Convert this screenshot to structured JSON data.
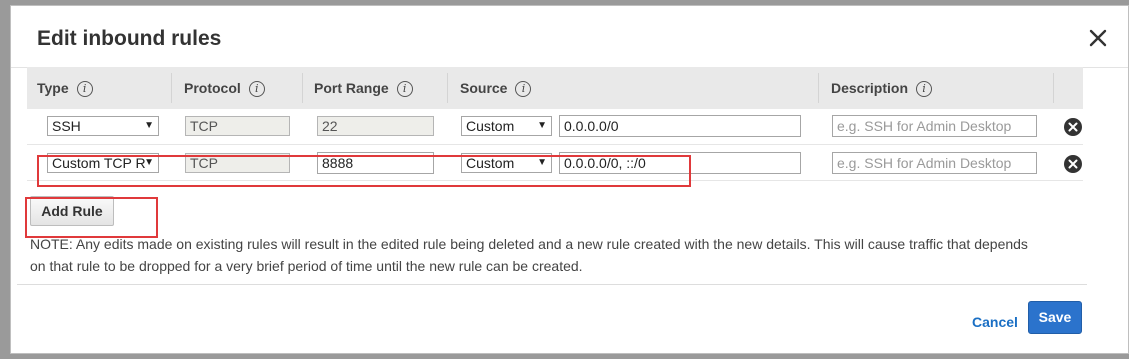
{
  "dialog": {
    "title": "Edit inbound rules",
    "close_icon": "close-icon"
  },
  "columns": {
    "type": "Type",
    "protocol": "Protocol",
    "port_range": "Port Range",
    "source": "Source",
    "description": "Description",
    "info_glyph": "i"
  },
  "rules": [
    {
      "type": "SSH",
      "protocol": "TCP",
      "port_range": "22",
      "source_mode": "Custom",
      "source_value": "0.0.0.0/0",
      "description_placeholder": "e.g. SSH for Admin Desktop"
    },
    {
      "type": "Custom TCP R",
      "protocol": "TCP",
      "port_range": "8888",
      "source_mode": "Custom",
      "source_value": "0.0.0.0/0, ::/0",
      "description_placeholder": "e.g. SSH for Admin Desktop"
    }
  ],
  "actions": {
    "add_rule": "Add Rule",
    "cancel": "Cancel",
    "save": "Save"
  },
  "note": "NOTE: Any edits made on existing rules will result in the edited rule being deleted and a new rule created with the new details. This will cause traffic that depends on that rule to be dropped for a very brief period of time until the new rule can be created.",
  "colors": {
    "highlight": "#e0393b",
    "primary": "#2b73cc",
    "link": "#1a6fc4"
  }
}
